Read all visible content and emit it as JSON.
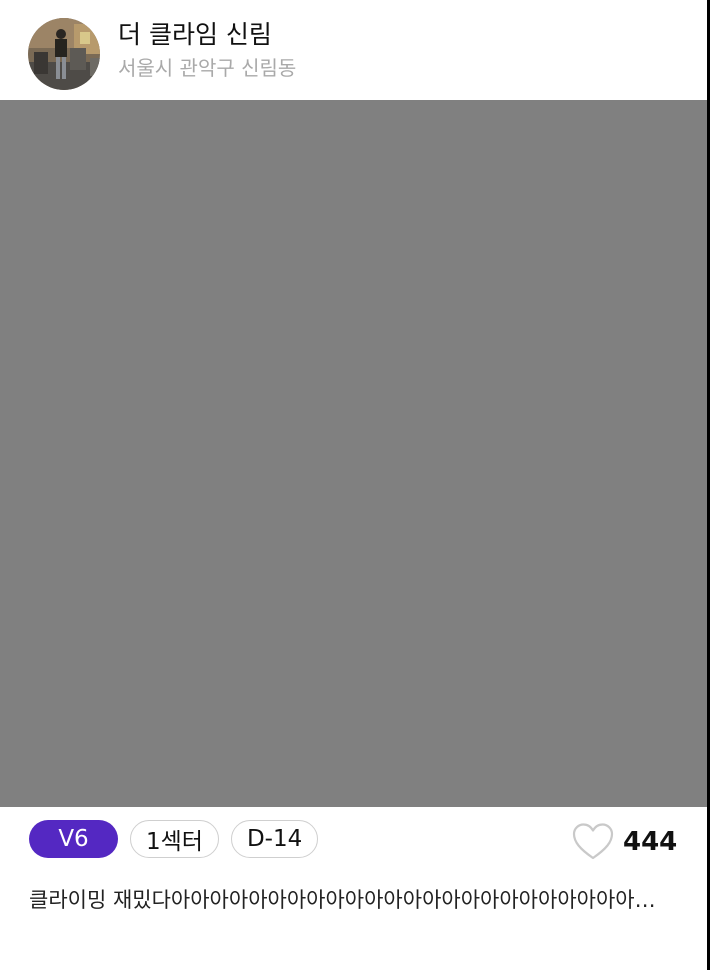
{
  "post": {
    "gym_name": "더 클라임 신림",
    "gym_location": "서울시 관악구 신림동",
    "tags": {
      "grade": "V6",
      "sector": "1섹터",
      "dday": "D-14"
    },
    "like_count": "444",
    "caption": "클라이밍 재밌다아아아아아아아아아아아아아아아아아아아아아아아아아아아아아아아아아아아아아아아아아아아아아",
    "icons": {
      "like": "heart-outline-icon"
    }
  },
  "colors": {
    "grade_tag": "#5428c2",
    "media_placeholder": "#808080",
    "location_text": "#a9a9a9"
  }
}
